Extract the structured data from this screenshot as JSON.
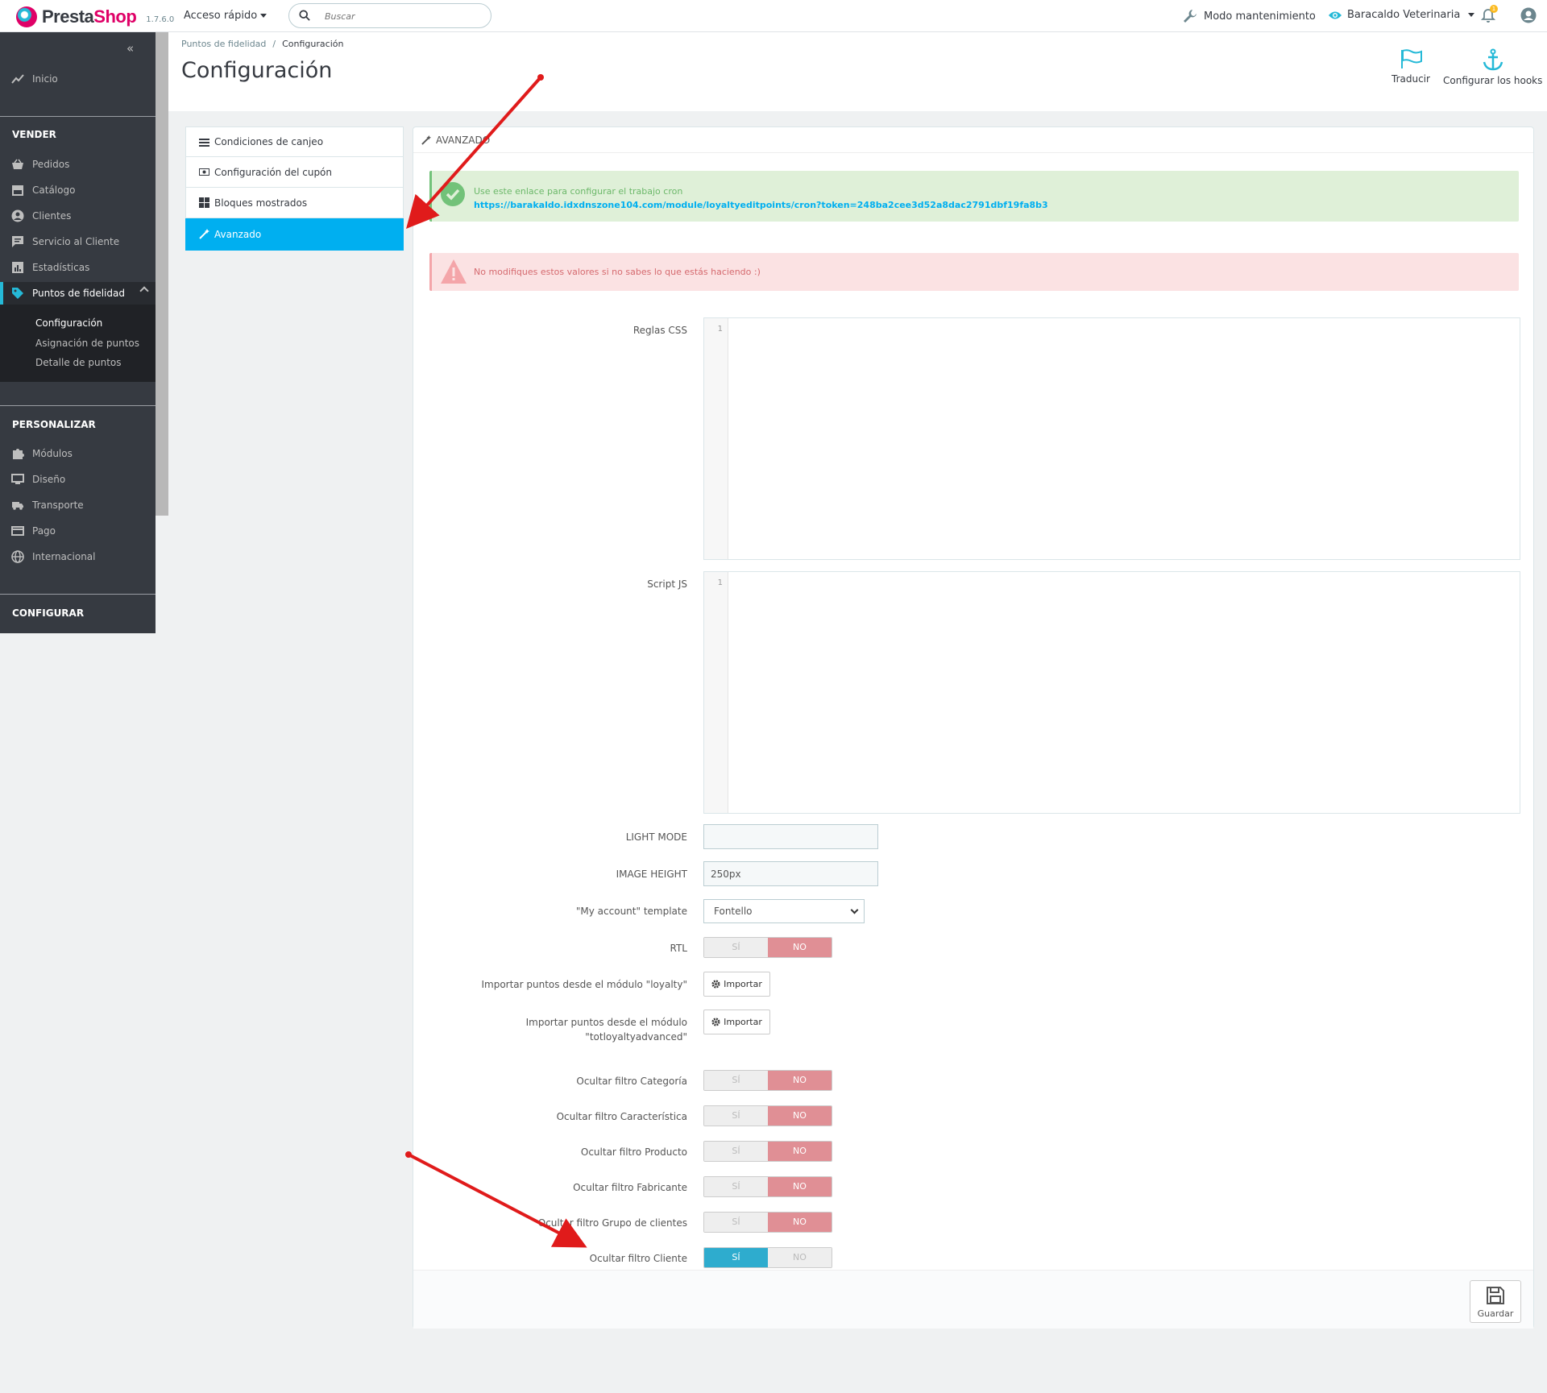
{
  "header": {
    "logo_main": "Presta",
    "logo_accent": "Shop",
    "version": "1.7.6.0",
    "quick_access": "Acceso rápido",
    "search_placeholder": "Buscar",
    "maintenance": "Modo mantenimiento",
    "shop_name": "Baracaldo Veterinaria",
    "notification_count": "1"
  },
  "sidebar": {
    "home": "Inicio",
    "sections": {
      "sell": "VENDER",
      "customize": "PERSONALIZAR",
      "configure": "CONFIGURAR"
    },
    "sell_items": [
      "Pedidos",
      "Catálogo",
      "Clientes",
      "Servicio al Cliente",
      "Estadísticas",
      "Puntos de fidelidad"
    ],
    "sub_items": [
      "Configuración",
      "Asignación de puntos",
      "Detalle de puntos"
    ],
    "customize_items": [
      "Módulos",
      "Diseño",
      "Transporte",
      "Pago",
      "Internacional"
    ]
  },
  "page": {
    "breadcrumb": [
      "Puntos de fidelidad",
      "Configuración"
    ],
    "title": "Configuración",
    "toolbar": {
      "translate": "Traducir",
      "hooks": "Configurar los hooks"
    }
  },
  "tabs": [
    "Condiciones de canjeo",
    "Configuración del cupón",
    "Bloques mostrados",
    "Avanzado"
  ],
  "panel": {
    "heading": "AVANZADO",
    "success_msg": "Use este enlace para configurar el trabajo cron",
    "cron_link": "https://barakaldo.idxdnszone104.com/module/loyaltyeditpoints/cron?token=248ba2cee3d52a8dac2791dbf19fa8b3",
    "warning_msg": "No modifiques estos valores si no sabes lo que estás haciendo :)",
    "css_label": "Reglas CSS",
    "js_label": "Script JS",
    "line_number": "1",
    "light_mode_label": "LIGHT MODE",
    "light_mode_value": "",
    "image_height_label": "IMAGE HEIGHT",
    "image_height_value": "250px",
    "template_label": "\"My account\" template",
    "template_value": "Fontello",
    "rtl_label": "RTL",
    "import_loyalty_label": "Importar puntos desde el módulo \"loyalty\"",
    "import_tot_label_1": "Importar puntos desde el módulo",
    "import_tot_label_2": "\"totloyaltyadvanced\"",
    "import_btn": "Importar",
    "filters": [
      {
        "label": "Ocultar filtro Categoría",
        "value": "NO"
      },
      {
        "label": "Ocultar filtro Característica",
        "value": "NO"
      },
      {
        "label": "Ocultar filtro Producto",
        "value": "NO"
      },
      {
        "label": "Ocultar filtro Fabricante",
        "value": "NO"
      },
      {
        "label": "Ocultar filtro Grupo de clientes",
        "value": "NO"
      },
      {
        "label": "Ocultar filtro Cliente",
        "value": "SÍ"
      }
    ],
    "switch_yes": "SÍ",
    "switch_no": "NO",
    "rtl_value": "NO",
    "save": "Guardar"
  },
  "colors": {
    "primary": "#25b9d7",
    "active_tab": "#00aff0",
    "brand_pink": "#df0067",
    "switch_no": "#e08f95",
    "switch_yes": "#2eacce",
    "arrow": "#e01b1b"
  }
}
